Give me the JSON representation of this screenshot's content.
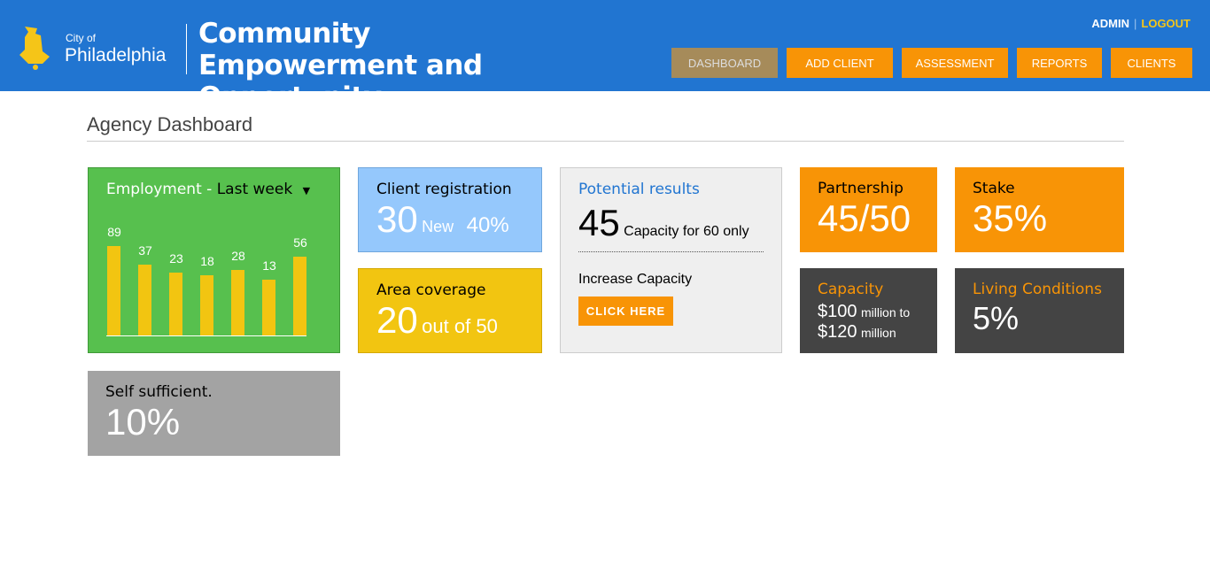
{
  "header": {
    "city_of": "City of",
    "city": "Philadelphia",
    "title": "Community Empowerment and Opportunity",
    "user": "ADMIN",
    "logout": "LOGOUT"
  },
  "nav": [
    "DASHBOARD",
    "ADD CLIENT",
    "ASSESSMENT",
    "REPORTS",
    "CLIENTS"
  ],
  "page_title": "Agency Dashboard",
  "employment": {
    "title": "Employment",
    "sep": " - ",
    "period": "Last week",
    "values": [
      89,
      37,
      23,
      18,
      28,
      13,
      56
    ]
  },
  "registration": {
    "title": "Client registration",
    "count": "30",
    "count_label": "New",
    "percent": "40%"
  },
  "area": {
    "title": "Area coverage",
    "value": "20",
    "suffix": "out of 50"
  },
  "potential": {
    "title": "Potential results",
    "value": "45",
    "note": "Capacity for 60 only",
    "increase": "Increase Capacity",
    "button": "CLICK HERE"
  },
  "partnership": {
    "title": "Partnership",
    "value": "45/50"
  },
  "stake": {
    "title": "Stake",
    "value": "35%"
  },
  "capacity": {
    "title": "Capacity",
    "v1": "$100",
    "u1": "million to",
    "v2": "$120",
    "u2": "million"
  },
  "living": {
    "title": "Living Conditions",
    "value": "5%"
  },
  "self": {
    "title": "Self sufficient.",
    "value": "10%"
  },
  "colors": {
    "header": "#2175d1",
    "orange": "#f89406",
    "green": "#57c04e",
    "yellow": "#f2c511",
    "blue": "#95c8fc",
    "dark": "#444444",
    "gray": "#a3a3a3"
  }
}
